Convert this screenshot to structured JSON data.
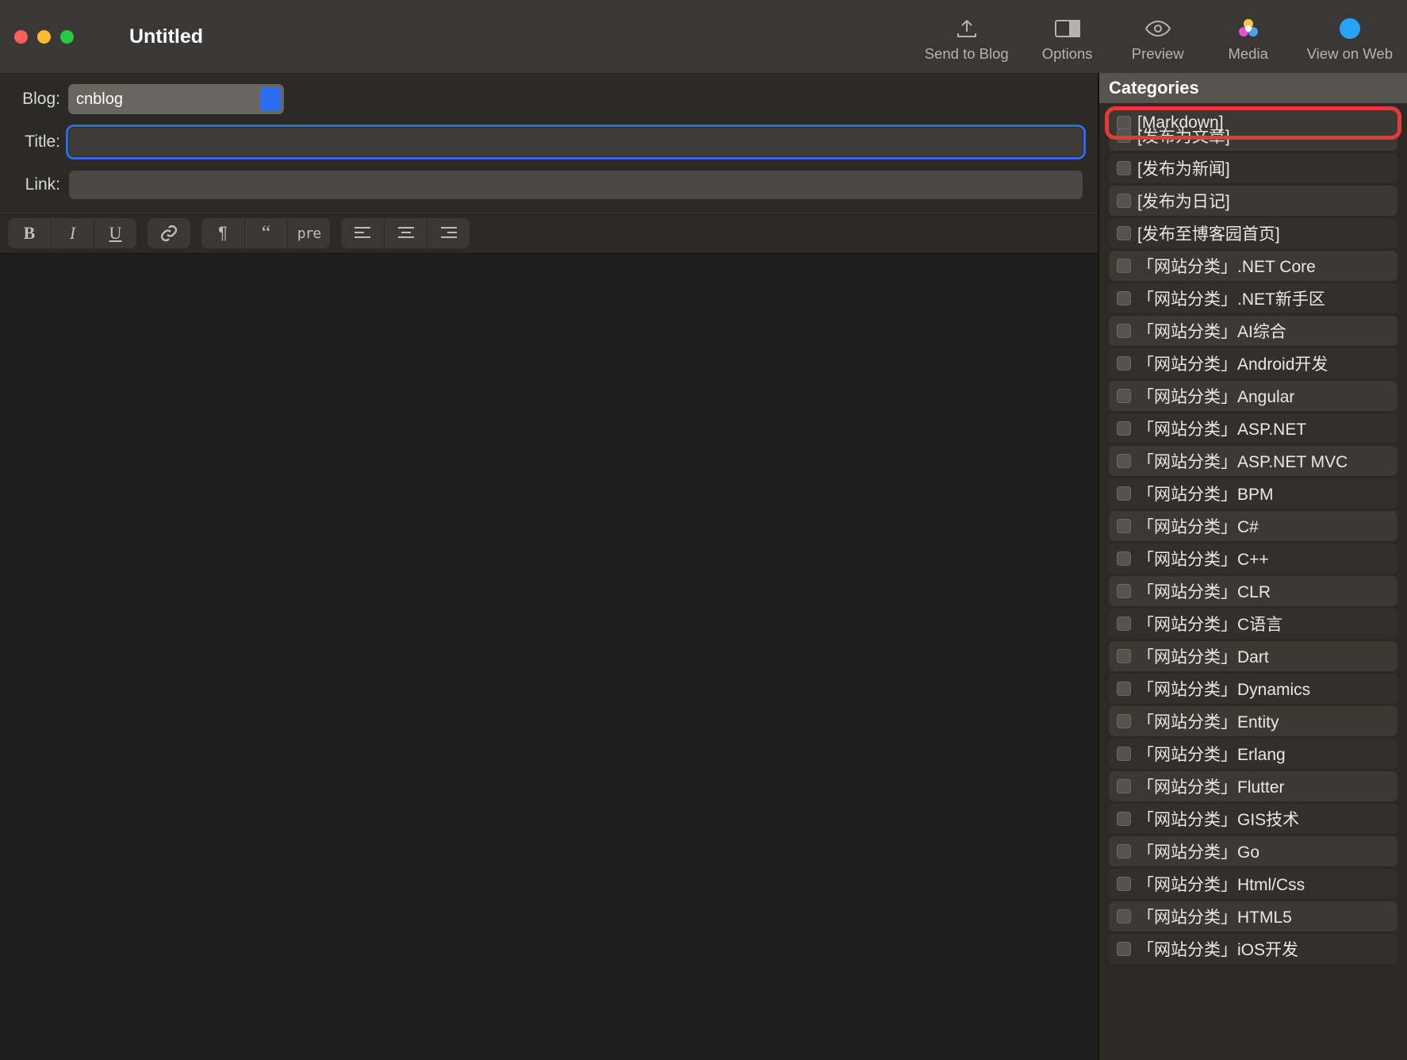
{
  "window": {
    "title": "Untitled"
  },
  "toolbar": {
    "sendToBlog": "Send to Blog",
    "options": "Options",
    "preview": "Preview",
    "media": "Media",
    "viewOnWeb": "View on Web"
  },
  "form": {
    "blogLabel": "Blog:",
    "blogValue": "cnblog",
    "titleLabel": "Title:",
    "titleValue": "",
    "linkLabel": "Link:",
    "linkValue": ""
  },
  "format": {
    "bold": "B",
    "italic": "I",
    "underline": "U",
    "pre": "pre"
  },
  "sidebar": {
    "header": "Categories",
    "items": [
      "[Markdown]",
      "[发布为文章]",
      "[发布为新闻]",
      "[发布为日记]",
      "[发布至博客园首页]",
      "「网站分类」.NET Core",
      "「网站分类」.NET新手区",
      "「网站分类」AI综合",
      "「网站分类」Android开发",
      "「网站分类」Angular",
      "「网站分类」ASP.NET",
      "「网站分类」ASP.NET MVC",
      "「网站分类」BPM",
      "「网站分类」C#",
      "「网站分类」C++",
      "「网站分类」CLR",
      "「网站分类」C语言",
      "「网站分类」Dart",
      "「网站分类」Dynamics",
      "「网站分类」Entity",
      "「网站分类」Erlang",
      "「网站分类」Flutter",
      "「网站分类」GIS技术",
      "「网站分类」Go",
      "「网站分类」Html/Css",
      "「网站分类」HTML5",
      "「网站分类」iOS开发"
    ],
    "highlightIndex": 0
  }
}
